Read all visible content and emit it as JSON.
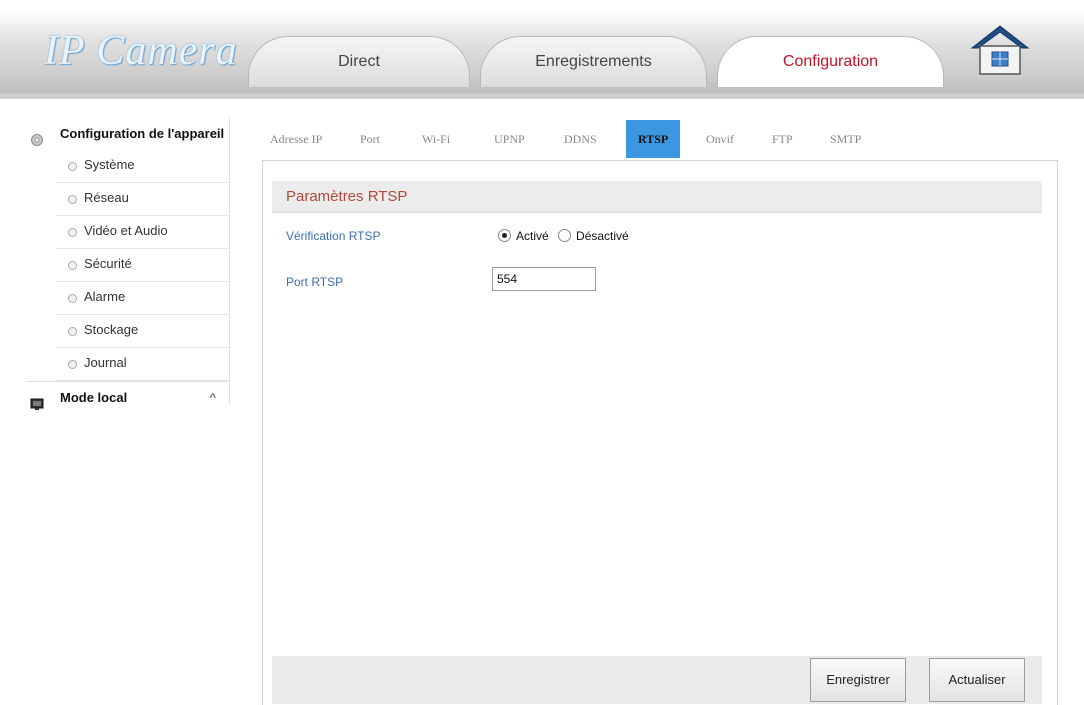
{
  "header": {
    "logo": "IP Camera",
    "tabs": [
      {
        "label": "Direct"
      },
      {
        "label": "Enregistrements"
      },
      {
        "label": "Configuration"
      }
    ],
    "active_tab": "Configuration",
    "active_color": "#c01428"
  },
  "sidebar": {
    "groups": [
      {
        "label": "Configuration de l'appareil",
        "items": [
          {
            "label": "Système"
          },
          {
            "label": "Réseau"
          },
          {
            "label": "Vidéo et Audio"
          },
          {
            "label": "Sécurité"
          },
          {
            "label": "Alarme"
          },
          {
            "label": "Stockage"
          },
          {
            "label": "Journal"
          }
        ]
      },
      {
        "label": "Mode local",
        "arrow": "^"
      }
    ]
  },
  "subtabs": [
    {
      "label": "Adresse IP"
    },
    {
      "label": "Port"
    },
    {
      "label": "Wi-Fi"
    },
    {
      "label": "UPNP"
    },
    {
      "label": "DDNS"
    },
    {
      "label": "RTSP"
    },
    {
      "label": "Onvif"
    },
    {
      "label": "FTP"
    },
    {
      "label": "SMTP"
    }
  ],
  "active_subtab": "RTSP",
  "accent_color": "#3a97e0",
  "form": {
    "section_title": "Paramètres RTSP",
    "verification_label": "Vérification RTSP",
    "option_on": "Activé",
    "option_off": "Désactivé",
    "selected_option": "Activé",
    "port_label": "Port RTSP",
    "port_value": "554"
  },
  "buttons": {
    "save": "Enregistrer",
    "refresh": "Actualiser"
  }
}
